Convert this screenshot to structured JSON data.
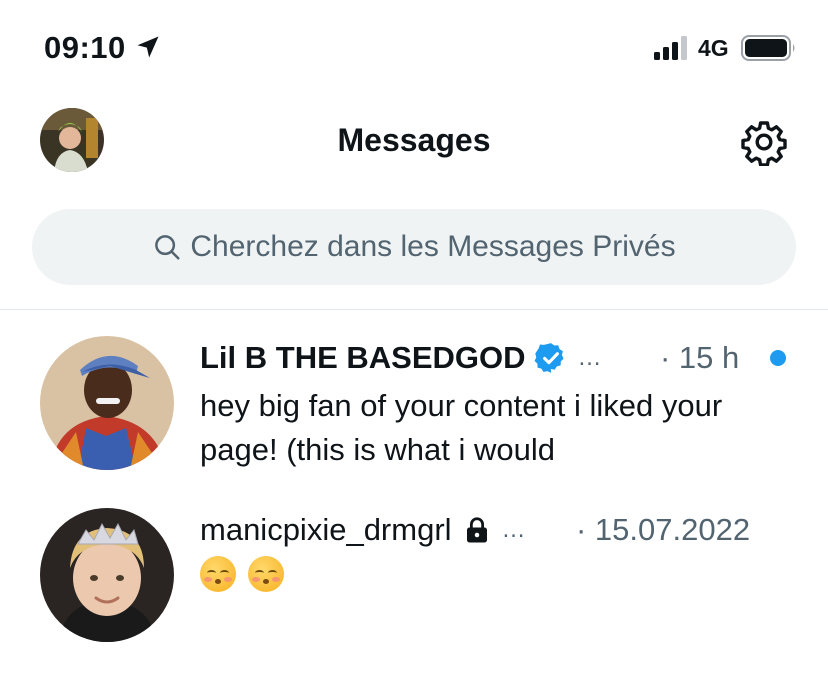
{
  "status_bar": {
    "time": "09:10",
    "network": "4G",
    "location_icon": "location-arrow-icon",
    "signal_icon": "signal-bars-icon",
    "battery_icon": "battery-icon"
  },
  "header": {
    "title": "Messages",
    "settings_icon": "gear-icon"
  },
  "search": {
    "placeholder": "Cherchez dans les Messages Privés",
    "icon": "search-icon"
  },
  "conversations": [
    {
      "name": "Lil B THE BASEDGOD",
      "verified": true,
      "ellipsis": "…",
      "timestamp": "· 15 h",
      "unread": true,
      "preview": "hey big fan of your content i liked your page!  (this is what i would"
    },
    {
      "name": "manicpixie_drmgrl",
      "locked": true,
      "ellipsis": "…",
      "timestamp": "· 15.07.2022",
      "unread": false,
      "preview_emoji": [
        "kissing-face-with-smiling-eyes",
        "kissing-face-with-smiling-eyes"
      ]
    }
  ],
  "colors": {
    "accent": "#1d9bf0",
    "secondary_text": "#536471",
    "search_bg": "#eff3f4"
  }
}
